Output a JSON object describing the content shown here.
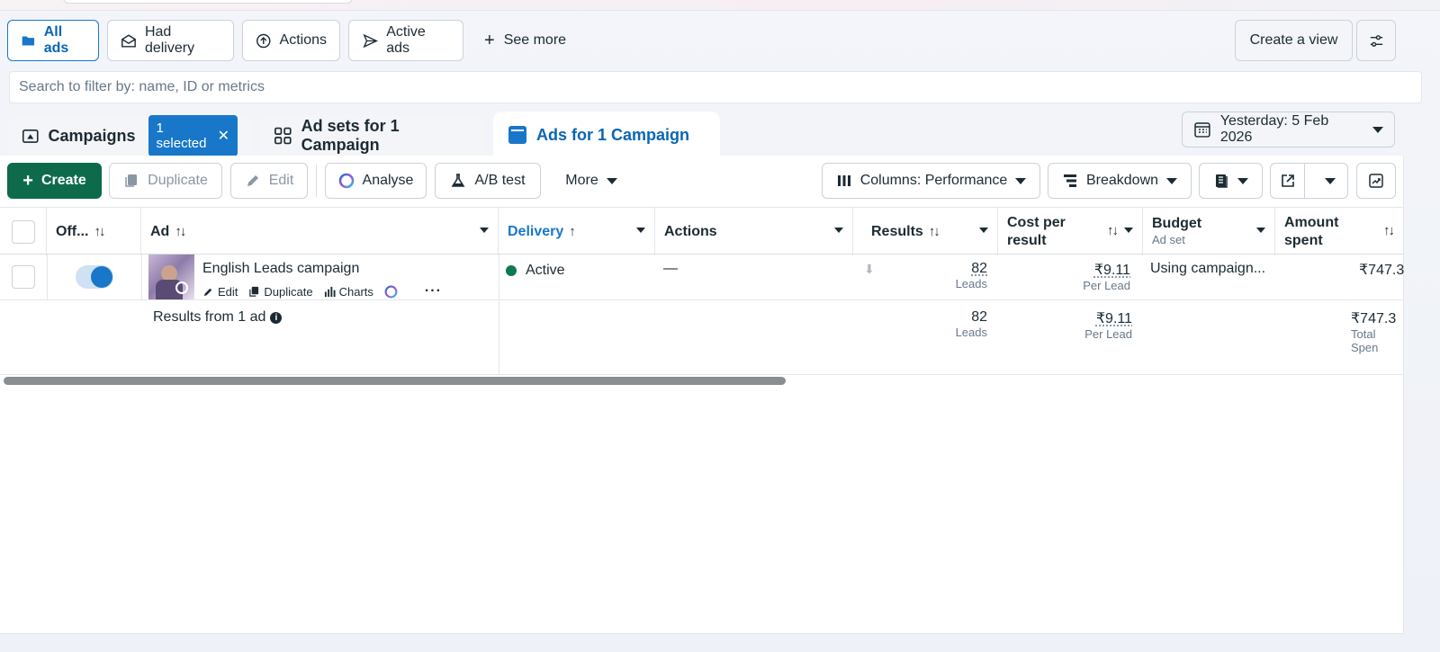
{
  "views": {
    "all_ads": "All ads",
    "had_delivery": "Had delivery",
    "actions": "Actions",
    "active_ads": "Active ads",
    "see_more": "See more",
    "create_view": "Create a view"
  },
  "search": {
    "placeholder": "Search to filter by: name, ID or metrics"
  },
  "tabs": {
    "campaigns": "Campaigns",
    "selected_badge": "1 selected",
    "ad_sets": "Ad sets for 1 Campaign",
    "ads": "Ads for 1 Campaign"
  },
  "date_range": "Yesterday: 5 Feb 2026",
  "toolbar": {
    "create": "Create",
    "duplicate": "Duplicate",
    "edit": "Edit",
    "analyse": "Analyse",
    "ab_test": "A/B test",
    "more": "More",
    "columns": "Columns: Performance",
    "breakdown": "Breakdown"
  },
  "columns": {
    "off_on": "Off...",
    "ad": "Ad",
    "delivery": "Delivery",
    "actions": "Actions",
    "results": "Results",
    "cost_per_result_1": "Cost per",
    "cost_per_result_2": "result",
    "budget": "Budget",
    "budget_sub": "Ad set",
    "amount_spent_1": "Amount",
    "amount_spent_2": "spent"
  },
  "rows": [
    {
      "ad_name": "English Leads campaign",
      "links": {
        "edit": "Edit",
        "duplicate": "Duplicate",
        "charts": "Charts"
      },
      "delivery": "Active",
      "actions": "—",
      "results": "82",
      "results_unit": "Leads",
      "cost_per_result": "₹9.11",
      "cost_unit": "Per Lead",
      "budget": "Using campaign...",
      "amount_spent": "₹747.3"
    }
  ],
  "summary": {
    "label": "Results from 1 ad",
    "results": "82",
    "results_unit": "Leads",
    "cost_per_result": "₹9.11",
    "cost_unit": "Per Lead",
    "amount_spent": "₹747.3",
    "amount_unit": "Total Spen"
  },
  "colors": {
    "accent": "#1877c9",
    "create_green": "#0d6b4c",
    "active_dot": "#0d7a4f"
  }
}
